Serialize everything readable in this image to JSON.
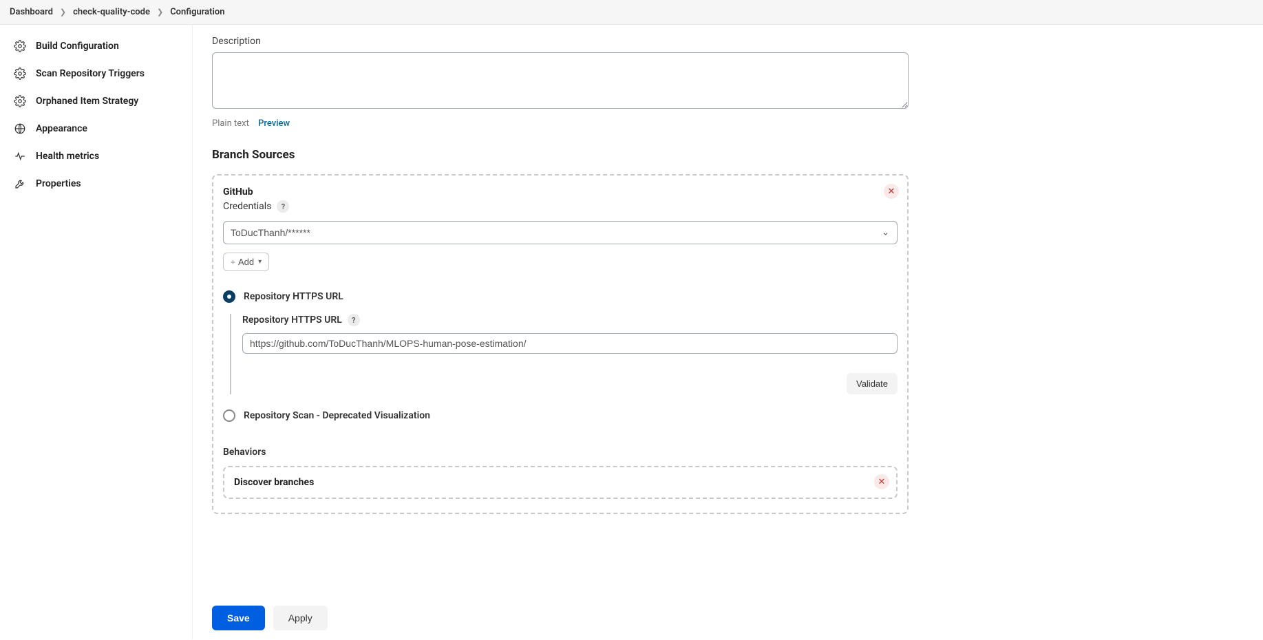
{
  "breadcrumb": {
    "items": [
      "Dashboard",
      "check-quality-code",
      "Configuration"
    ]
  },
  "sidebar": {
    "items": [
      {
        "icon": "gear",
        "label": "Build Configuration"
      },
      {
        "icon": "gear",
        "label": "Scan Repository Triggers"
      },
      {
        "icon": "gear",
        "label": "Orphaned Item Strategy"
      },
      {
        "icon": "globe",
        "label": "Appearance"
      },
      {
        "icon": "pulse",
        "label": "Health metrics"
      },
      {
        "icon": "wrench",
        "label": "Properties"
      }
    ]
  },
  "description": {
    "label": "Description",
    "value": "",
    "tabs": {
      "plain": "Plain text",
      "preview": "Preview"
    }
  },
  "branch_sources": {
    "title": "Branch Sources",
    "github": {
      "title": "GitHub",
      "credentials_label": "Credentials",
      "credentials_value": "ToDucThanh/******",
      "add_button": "Add",
      "radio_https": {
        "label": "Repository HTTPS URL",
        "field_label": "Repository HTTPS URL",
        "value": "https://github.com/ToDucThanh/MLOPS-human-pose-estimation/",
        "validate": "Validate"
      },
      "radio_scan": {
        "label": "Repository Scan - Deprecated Visualization"
      },
      "behaviors": {
        "label": "Behaviors",
        "discover_branches": "Discover branches"
      }
    }
  },
  "footer": {
    "save": "Save",
    "apply": "Apply"
  }
}
